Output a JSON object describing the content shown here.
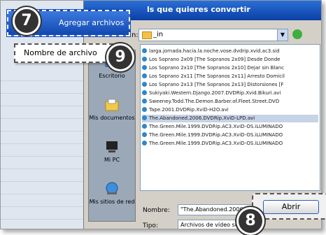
{
  "dialog": {
    "title": "ls que quieres convertir",
    "look_in_label": "n:",
    "look_in_value": "_in",
    "filename_label": "Nombre:",
    "filename_value": "\"The.Abandoned.2006.DVDrip",
    "type_label": "Tipo:",
    "type_value": "Archivos de vídeo so",
    "open_button": "Abrir"
  },
  "places": [
    {
      "label": "Escritorio",
      "icon": "desktop-icon"
    },
    {
      "label": "Mis documentos",
      "icon": "documents-icon"
    },
    {
      "label": "Mi PC",
      "icon": "computer-icon"
    },
    {
      "label": "Mis sitios de red",
      "icon": "network-icon"
    }
  ],
  "files": [
    "larga.jornada.hacia.la.noche.vose.dvdrip.xvid.ac3.sid",
    "Los Soprano 2x09 [The Sopranos 2x09] Desde Donde",
    "Los Soprano 2x10 [The Sopranos 2x10] Dejar sin Blanc",
    "Los Soprano 2x11 [The Sopranos 2x11] Arresto Domicil",
    "Los Soprano 2x13 [The Sopranos 2x13] Distorsiones [F",
    "Sukiyaki.Western.Django.2007.DVDRip.Xvid.Bikuri.avi",
    "Sweeney.Todd.The.Demon.Barber.of.Fleet.Street.DVD",
    "Tape.2001.DVDRip.XviD-H2O.avi",
    "The.Abandoned.2006.DVDRip.XviD-LPD.avi",
    "The.Green.Mile.1999.DVDRip.AC3.XviD-OS.iLUMINADO",
    "The.Green.Mile.1999.DVDRip.AC3.XviD-OS.iLUMINADO",
    "The.Green.Mile.1999.DVDRip.AC3.XviD-OS.iLUMINADO"
  ],
  "callout_menu": {
    "add_files": "Agregar archivos",
    "by_filename": "Nombre de archivo"
  },
  "badges": {
    "seven": "7",
    "nine": "9",
    "eight": "8"
  },
  "colors": {
    "accent": "#1248b0",
    "selection": "#c7d3e6"
  }
}
